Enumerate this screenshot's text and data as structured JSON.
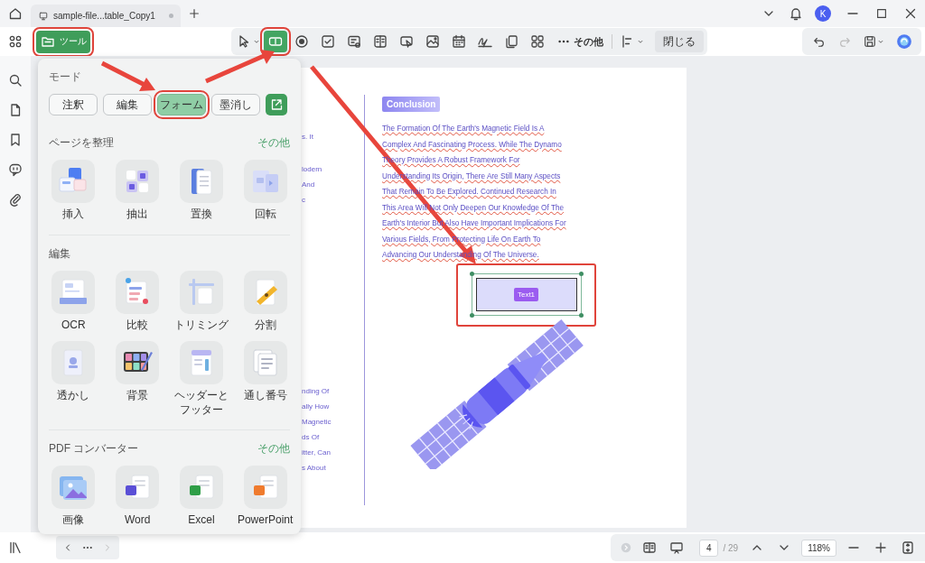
{
  "window": {
    "tab_title": "sample-file...table_Copy1",
    "user_initial": "K"
  },
  "toolbar": {
    "tools_button": {
      "label": "ツール",
      "highlighted": true
    },
    "form_tools": [
      {
        "kind": "select",
        "selected": false,
        "highlighted": false
      },
      {
        "kind": "text-field",
        "selected": true,
        "highlighted": true
      },
      {
        "kind": "radio",
        "selected": false,
        "highlighted": false
      },
      {
        "kind": "checkbox",
        "selected": false,
        "highlighted": false
      },
      {
        "kind": "combo",
        "selected": false,
        "highlighted": false
      },
      {
        "kind": "list",
        "selected": false,
        "highlighted": false
      },
      {
        "kind": "button",
        "selected": false,
        "highlighted": false
      },
      {
        "kind": "image",
        "selected": false,
        "highlighted": false
      },
      {
        "kind": "date",
        "selected": false,
        "highlighted": false
      },
      {
        "kind": "signature",
        "selected": false,
        "highlighted": false
      },
      {
        "kind": "copy",
        "selected": false,
        "highlighted": false
      },
      {
        "kind": "grid",
        "selected": false,
        "highlighted": false
      }
    ],
    "more": "その他",
    "close": "閉じる",
    "redo_disabled": true
  },
  "tools_panel": {
    "mode_title": "モード",
    "modes": [
      {
        "label": "注釈",
        "selected": false,
        "highlighted": false
      },
      {
        "label": "編集",
        "selected": false,
        "highlighted": false
      },
      {
        "label": "フォーム",
        "selected": true,
        "highlighted": true
      },
      {
        "label": "墨消し",
        "selected": false,
        "highlighted": false
      }
    ],
    "sections": [
      {
        "title": "ページを整理",
        "more": "その他",
        "items": [
          {
            "label": "挿入",
            "kind": "insert"
          },
          {
            "label": "抽出",
            "kind": "extract"
          },
          {
            "label": "置換",
            "kind": "replace"
          },
          {
            "label": "回転",
            "kind": "rotate"
          }
        ]
      },
      {
        "title": "編集",
        "items": [
          {
            "label": "OCR",
            "kind": "ocr"
          },
          {
            "label": "比較",
            "kind": "compare"
          },
          {
            "label": "トリミング",
            "kind": "crop"
          },
          {
            "label": "分割",
            "kind": "split"
          },
          {
            "label": "透かし",
            "kind": "watermark"
          },
          {
            "label": "背景",
            "kind": "background"
          },
          {
            "label": "ヘッダーとフッター",
            "kind": "header-footer"
          },
          {
            "label": "通し番号",
            "kind": "numbering"
          }
        ]
      },
      {
        "title": "PDF コンバーター",
        "more": "その他",
        "items": [
          {
            "label": "画像",
            "kind": "image"
          },
          {
            "label": "Word",
            "kind": "word"
          },
          {
            "label": "Excel",
            "kind": "excel"
          },
          {
            "label": "PowerPoint",
            "kind": "powerpoint"
          }
        ]
      }
    ]
  },
  "document": {
    "column_fragments": [
      [
        "s. It"
      ],
      [
        "lodern",
        "And",
        "c"
      ],
      [
        "nding Of",
        "ally How",
        "Magnetic",
        "ds Of",
        "itter, Can",
        "s About"
      ]
    ],
    "heading": "Conclusion",
    "paragraph": "The Formation Of The Earth's Magnetic Field Is A Complex And Fascinating Process. While The Dynamo Theory Provides A Robust Framework For Understanding Its Origin, There Are Still Many Aspects That Remain To Be Explored. Continued Research In This Area Will Not Only Deepen Our Knowledge Of The Earth's Interior But Also Have Important Implications For Various Fields, From Protecting Life On Earth To Advancing Our Understanding Of The Universe.",
    "form_field": {
      "label": "Text1",
      "selected": true,
      "highlighted": true
    }
  },
  "status_bar": {
    "next_disabled": true,
    "page": "4",
    "page_count": "/ 29",
    "zoom": "118%"
  }
}
